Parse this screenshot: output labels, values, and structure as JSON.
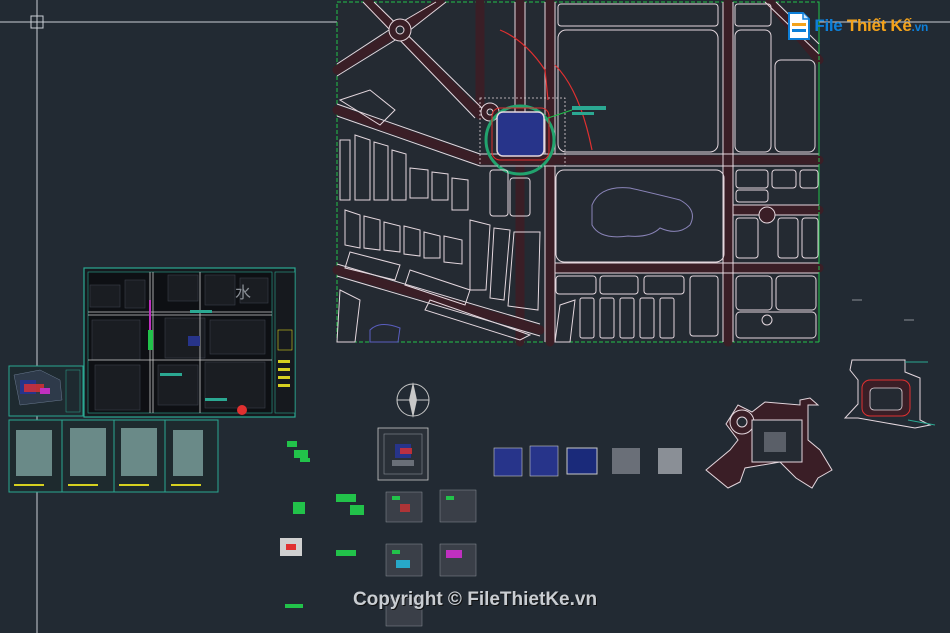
{
  "logo": {
    "text": "File Thiết Kế.vn",
    "icon": "file-icon",
    "colors": {
      "blue": "#0d7fd8",
      "orange": "#f3a21b"
    }
  },
  "watermark": {
    "text": "Copyright © FileThietKe.vn"
  },
  "viewport": {
    "background": "#222a33",
    "crosshair_color": "#c9ced6",
    "road_color": "#e4d7de",
    "road_fill": "#3a1e26",
    "boundary_color": "#22c24a",
    "highlight_color": "#e03030",
    "building_color": "#27348a"
  }
}
